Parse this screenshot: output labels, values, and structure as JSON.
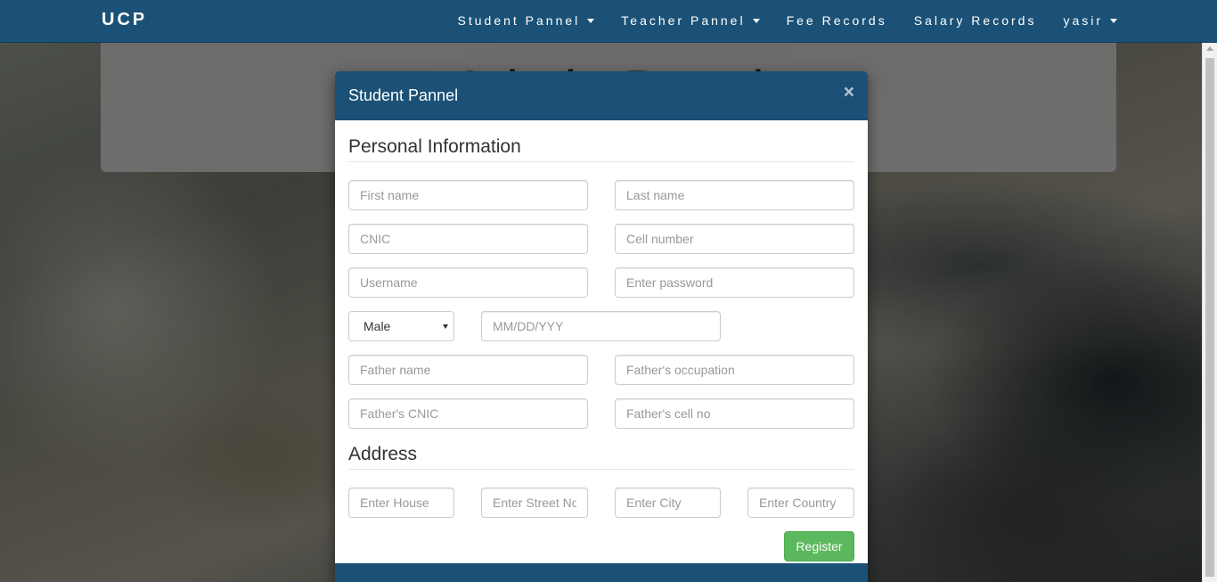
{
  "navbar": {
    "brand": "UCP",
    "items": [
      {
        "label": "Student Pannel",
        "dropdown": true
      },
      {
        "label": "Teacher Pannel",
        "dropdown": true
      },
      {
        "label": "Fee Records",
        "dropdown": false
      },
      {
        "label": "Salary Records",
        "dropdown": false
      },
      {
        "label": "yasir",
        "dropdown": true
      }
    ]
  },
  "jumbotron": {
    "heading": "Admin Panel"
  },
  "modal": {
    "title": "Student Pannel",
    "close_icon": "×",
    "personal_heading": "Personal Information",
    "address_heading": "Address",
    "fields": {
      "first_name": "First name",
      "last_name": "Last name",
      "cnic": "CNIC",
      "cell_number": "Cell number",
      "username": "Username",
      "password": "Enter password",
      "dob": "MM/DD/YYY",
      "father_name": "Father name",
      "father_occupation": "Father's occupation",
      "father_cnic": "Father's CNIC",
      "father_cell": "Father's cell no",
      "house": "Enter House",
      "street": "Enter Street No",
      "city": "Enter City",
      "country": "Enter Country"
    },
    "gender": {
      "selected": "Male"
    },
    "register_label": "Register"
  },
  "colors": {
    "navbar": "#1b5176",
    "register_button": "#5cb85c"
  }
}
